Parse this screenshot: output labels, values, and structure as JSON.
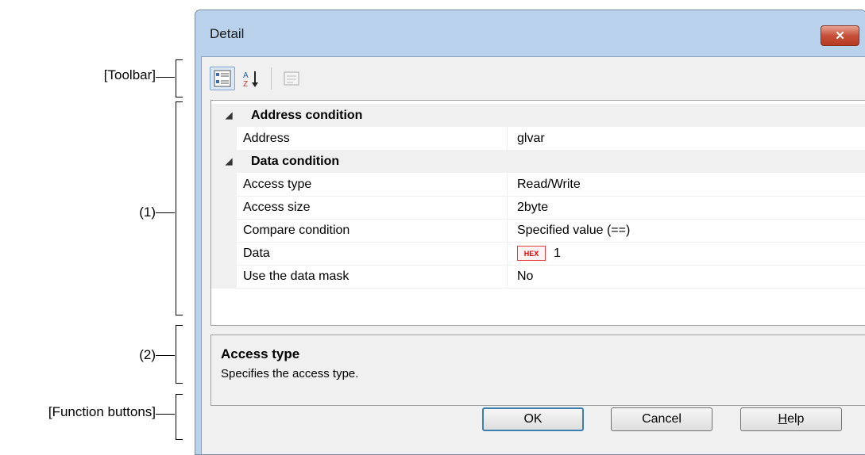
{
  "callouts": {
    "toolbar": "[Toolbar]",
    "area1": "(1)",
    "area2": "(2)",
    "function_buttons": "[Function buttons]"
  },
  "window": {
    "title": "Detail",
    "close_glyph": "✕"
  },
  "toolbar": {
    "buttons": [
      {
        "icon": "categorized-view-icon",
        "active": true
      },
      {
        "icon": "sort-alphabetical-icon",
        "active": false
      },
      {
        "icon": "property-pages-icon",
        "active": false,
        "disabled": true
      }
    ]
  },
  "grid": {
    "categories": [
      {
        "label": "Address condition",
        "properties": [
          {
            "name": "Address",
            "value": "glvar"
          }
        ]
      },
      {
        "label": "Data condition",
        "properties": [
          {
            "name": "Access type",
            "value": "Read/Write"
          },
          {
            "name": "Access size",
            "value": "2byte"
          },
          {
            "name": "Compare condition",
            "value": "Specified value (==)"
          },
          {
            "name": "Data",
            "badge": "HEX",
            "value": "1"
          },
          {
            "name": "Use the data mask",
            "value": "No"
          }
        ]
      }
    ]
  },
  "description": {
    "title": "Access type",
    "text": "Specifies the access type."
  },
  "buttons": {
    "ok": "OK",
    "cancel": "Cancel",
    "help_prefix": "H",
    "help_rest": "elp"
  },
  "colors": {
    "title_bar": "#b9d1ea",
    "close_button": "#c7503a",
    "hex_badge": "#e00000"
  }
}
